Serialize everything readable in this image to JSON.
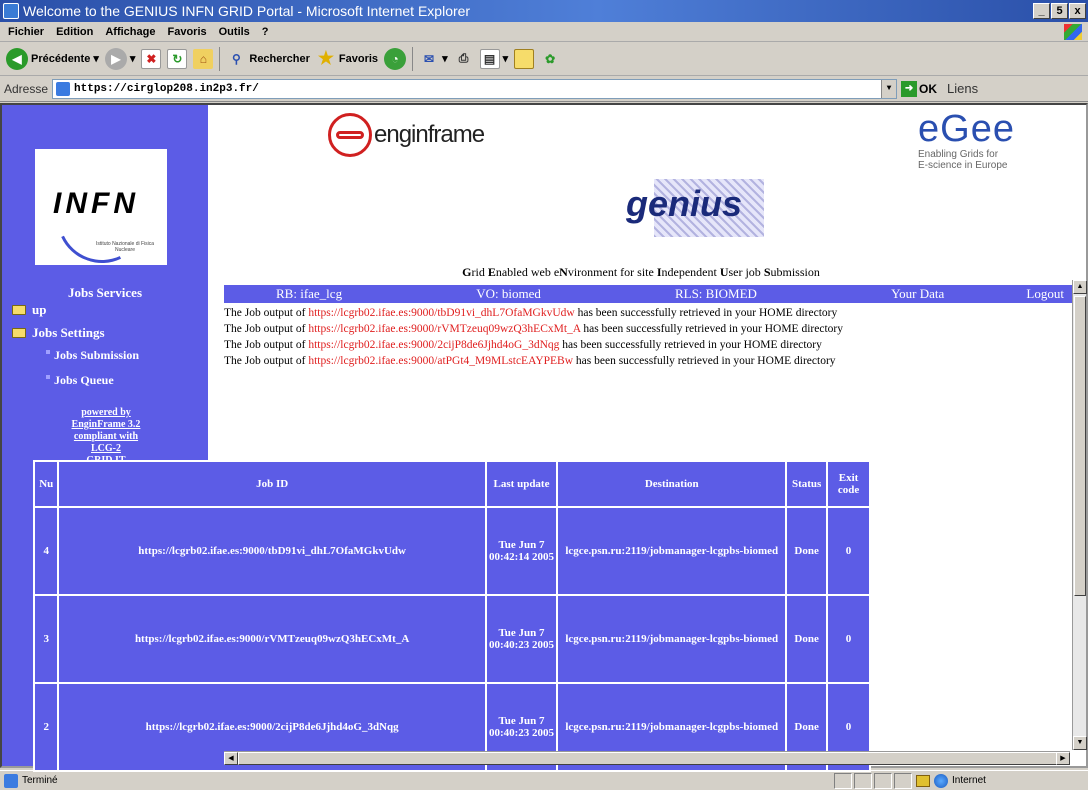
{
  "window": {
    "title": "Welcome to the GENIUS INFN GRID Portal - Microsoft Internet Explorer",
    "min": "_",
    "max": "5",
    "close": "x"
  },
  "menu": [
    "Fichier",
    "Edition",
    "Affichage",
    "Favoris",
    "Outils",
    "?"
  ],
  "toolbar": {
    "back": "Précédente",
    "search": "Rechercher",
    "favorites": "Favoris"
  },
  "address": {
    "label": "Adresse",
    "url": "https://cirglop208.in2p3.fr/",
    "go": "OK",
    "links": "Liens"
  },
  "sidebar": {
    "logo_text": "INFN",
    "logo_sub": "Istituto Nazionale di Fisica Nucleare",
    "title": "Jobs Services",
    "items": [
      {
        "label": "up"
      },
      {
        "label": "Jobs Settings"
      },
      {
        "label": "Jobs Submission"
      },
      {
        "label": "Jobs Queue"
      }
    ],
    "powered": [
      "powered by",
      "EnginFrame 3.2",
      "compliant with",
      "LCG-2",
      "GRID.IT"
    ]
  },
  "header": {
    "enginframe": "enginframe",
    "genius": "genius",
    "egee_big": "eGee",
    "egee_small1": "Enabling Grids for",
    "egee_small2": "E-science in Europe",
    "tagline": [
      {
        "b": "G",
        "t": "rid "
      },
      {
        "b": "E",
        "t": "nabled web e"
      },
      {
        "b": "N",
        "t": "vironment for site "
      },
      {
        "b": "I",
        "t": "ndependent "
      },
      {
        "b": "U",
        "t": "ser job "
      },
      {
        "b": "S",
        "t": "ubmission"
      }
    ]
  },
  "navbar": {
    "rb": "RB: ifae_lcg",
    "vo": "VO: biomed",
    "rls": "RLS: BIOMED",
    "data": "Your Data",
    "logout": "Logout"
  },
  "messages": {
    "prefix": "The Job output of ",
    "suffix": " has been successfully retrieved in your HOME directory",
    "links": [
      "https://lcgrb02.ifae.es:9000/tbD91vi_dhL7OfaMGkvUdw",
      "https://lcgrb02.ifae.es:9000/rVMTzeuq09wzQ3hECxMt_A",
      "https://lcgrb02.ifae.es:9000/2cijP8de6Jjhd4oG_3dNqg",
      "https://lcgrb02.ifae.es:9000/atPGt4_M9MLstcEAYPEBw"
    ]
  },
  "jobs": {
    "headers": [
      "Nu",
      "Job ID",
      "Last update",
      "Destination",
      "Status",
      "Exit code"
    ],
    "rows": [
      {
        "nu": "4",
        "id": "https://lcgrb02.ifae.es:9000/tbD91vi_dhL7OfaMGkvUdw",
        "update": "Tue Jun 7 00:42:14 2005",
        "dest": "lcgce.psn.ru:2119/jobmanager-lcgpbs-biomed",
        "status": "Done",
        "exit": "0"
      },
      {
        "nu": "3",
        "id": "https://lcgrb02.ifae.es:9000/rVMTzeuq09wzQ3hECxMt_A",
        "update": "Tue Jun 7 00:40:23 2005",
        "dest": "lcgce.psn.ru:2119/jobmanager-lcgpbs-biomed",
        "status": "Done",
        "exit": "0"
      },
      {
        "nu": "2",
        "id": "https://lcgrb02.ifae.es:9000/2cijP8de6Jjhd4oG_3dNqg",
        "update": "Tue Jun 7 00:40:23 2005",
        "dest": "lcgce.psn.ru:2119/jobmanager-lcgpbs-biomed",
        "status": "Done",
        "exit": "0"
      }
    ]
  },
  "status": {
    "left": "Terminé",
    "zone": "Internet"
  }
}
